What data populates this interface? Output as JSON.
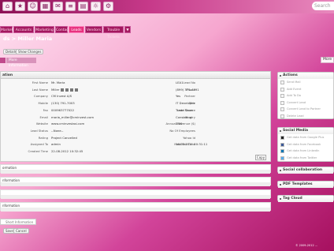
{
  "topbar": {
    "icons": [
      "home-icon",
      "bookmark-icon",
      "user-icon",
      "calendar-icon",
      "mail-icon",
      "list-icon",
      "chart-icon",
      "folder-icon",
      "lightbulb-icon",
      "gear-icon",
      "search-icon"
    ],
    "search_placeholder": "Search"
  },
  "nav": {
    "tabs": [
      {
        "label": "Market"
      },
      {
        "label": "Accounts"
      },
      {
        "label": "Marketing"
      },
      {
        "label": "Contacts"
      },
      {
        "label": "Leads"
      },
      {
        "label": "Vendors"
      },
      {
        "label": "Trouble Tickets"
      },
      {
        "label": "▼"
      }
    ],
    "active_index": 4
  },
  "page": {
    "title": "ds > Miller Maria",
    "btn_details": "Details",
    "btn_show": "Show Changes",
    "tab_left": "",
    "tab_right": "More Information",
    "sidebar_btn": "More"
  },
  "main": {
    "heading": "ation",
    "left_fields": [
      {
        "label": "First Name",
        "value": "Mr. Maria"
      },
      {
        "label": "Last Name",
        "value": "Miller"
      },
      {
        "label": "Company",
        "value": "CM Invest A/S"
      },
      {
        "label": "Mobile",
        "value": "(130) 791-7003"
      },
      {
        "label": "Fax",
        "value": "000963777022"
      },
      {
        "label": "Email",
        "value": "maria_miller@cminvest.com"
      },
      {
        "label": "Website",
        "value": "www.cminvestasi.com"
      },
      {
        "label": "Lead Status",
        "value": "--None--"
      },
      {
        "label": "Rating",
        "value": "Project Cancelled"
      },
      {
        "label": "Assigned To",
        "value": "admin"
      },
      {
        "label": "Created Time",
        "value": "22-08-2012 10:32:45"
      }
    ],
    "right_fields": [
      {
        "label": "Lead No",
        "value": "LEA1"
      },
      {
        "label": "Phone",
        "value": "(899) 371-4391"
      },
      {
        "label": "Partner",
        "value": "Yes"
      },
      {
        "label": "Title",
        "value": "IT Developer"
      },
      {
        "label": "Lead Source",
        "value": "Trade Show"
      },
      {
        "label": "Industry",
        "value": "Consulting"
      },
      {
        "label": "Annual Revenue ($)",
        "value": "0.00"
      },
      {
        "label": "No Of Employees",
        "value": ""
      },
      {
        "label": "Yahoo Id",
        "value": ""
      },
      {
        "label": "Modified Time",
        "value": "16-07-2011 20:31:11"
      }
    ],
    "copy_label": "Copy"
  },
  "sections": [
    {
      "title": "ormation"
    },
    {
      "title": "nformation"
    },
    {
      "title": ""
    },
    {
      "title": "nformation"
    }
  ],
  "sidebar": {
    "actions": {
      "title": "Actions",
      "items": [
        "Send Mail",
        "Add Event",
        "Add To Do",
        "Convert Lead",
        "Convert Lead to Partner",
        "Delete Lead"
      ]
    },
    "social": {
      "title": "Social Media",
      "items": [
        "Get data from Google Plus",
        "Get data from Facebook",
        "Get data from LinkedIn",
        "Get data from Twitter"
      ]
    },
    "collab": {
      "title": "Social collaboration"
    },
    "pdf": {
      "title": "PDF Templates"
    },
    "tagcloud": {
      "title": "Tag Cloud"
    }
  },
  "comment": {
    "tab": "Short Information",
    "btn_save": "Save",
    "btn_cancel": "Cancel"
  },
  "footer": "© 2009-2012 ..."
}
